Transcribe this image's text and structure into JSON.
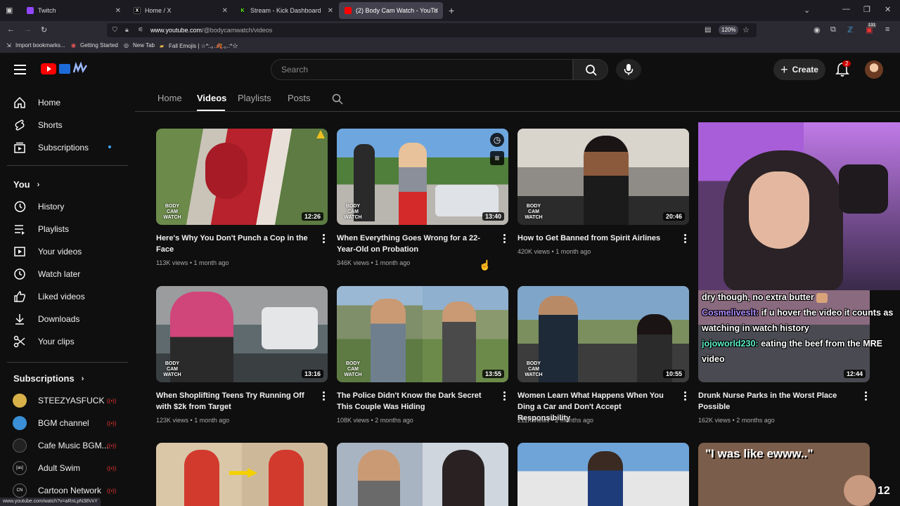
{
  "browser": {
    "tabs": [
      {
        "label": "Twitch",
        "color": "#9146ff",
        "glyph": ""
      },
      {
        "label": "Home / X",
        "color": "#000000",
        "glyph": "X"
      },
      {
        "label": "Stream - Kick Dashboard",
        "color": "#53fc18",
        "glyph": "K"
      },
      {
        "label": "(2) Body Cam Watch - YouTube",
        "color": "#ff0000",
        "glyph": "▶"
      }
    ],
    "url_host": "www.youtube.com",
    "url_path": "/@bodycamwatch/videos",
    "zoom": "120%",
    "bookmarks": [
      "Import bookmarks...",
      "Getting Started",
      "New Tab",
      "Fall Emojis | ☆*:.｡.🍂.｡.:*☆"
    ],
    "ext_badge": "131",
    "status_url": "www.youtube.com/watch?v=aRnLpN38VxY"
  },
  "youtube": {
    "search_placeholder": "Search",
    "create_label": "Create",
    "notif_count": "2"
  },
  "sidebar": {
    "main": [
      {
        "label": "Home",
        "icon": "home-icon"
      },
      {
        "label": "Shorts",
        "icon": "shorts-icon"
      },
      {
        "label": "Subscriptions",
        "icon": "subscriptions-icon"
      }
    ],
    "you_header": "You",
    "you_items": [
      {
        "label": "History",
        "icon": "history-icon"
      },
      {
        "label": "Playlists",
        "icon": "playlists-icon"
      },
      {
        "label": "Your videos",
        "icon": "your-videos-icon"
      },
      {
        "label": "Watch later",
        "icon": "watch-later-icon"
      },
      {
        "label": "Liked videos",
        "icon": "liked-videos-icon"
      },
      {
        "label": "Downloads",
        "icon": "downloads-icon"
      },
      {
        "label": "Your clips",
        "icon": "clips-icon"
      }
    ],
    "subs_header": "Subscriptions",
    "subs": [
      {
        "label": "STEEZYASFUCK",
        "color": "#d8b04a"
      },
      {
        "label": "BGM channel",
        "color": "#3a8fd6"
      },
      {
        "label": "Cafe Music BGM...",
        "color": "#222222"
      },
      {
        "label": "Adult Swim",
        "color": "#111111"
      },
      {
        "label": "Cartoon Network",
        "color": "#111111"
      }
    ]
  },
  "channel_tabs": [
    "Home",
    "Videos",
    "Playlists",
    "Posts"
  ],
  "videos": [
    {
      "title": "Here's Why You Don't Punch a Cop in the Face",
      "views": "113K views",
      "age": "1 month ago",
      "duration": "12:26"
    },
    {
      "title": "When Everything Goes Wrong for a 22-Year-Old on Probation",
      "views": "346K views",
      "age": "1 month ago",
      "duration": "13:40"
    },
    {
      "title": "How to Get Banned from Spirit Airlines",
      "views": "420K views",
      "age": "1 month ago",
      "duration": "20:46"
    },
    {
      "title": "When Shoplifting Teens Try Running Off with $2k from Target",
      "views": "123K views",
      "age": "1 month ago",
      "duration": "13:16"
    },
    {
      "title": "The Police Didn't Know the Dark Secret This Couple Was Hiding",
      "views": "108K views",
      "age": "2 months ago",
      "duration": "13:55"
    },
    {
      "title": "Women Learn What Happens When You Ding a Car and Don't Accept Responsibility",
      "views": "211K views",
      "age": "2 months ago",
      "duration": "10:55"
    },
    {
      "title": "Drunk Nurse Parks in the Worst Place Possible",
      "views": "162K views",
      "age": "2 months ago",
      "duration": "12:44"
    }
  ],
  "thumb_watermark": "BODY CAM WATCH",
  "overlay": {
    "chat": [
      {
        "user": "",
        "text": "dry though, no extra butter"
      },
      {
        "user": "Cosmeliveslt:",
        "text": "if u hover the video it counts as watching in watch history"
      },
      {
        "user": "jojoworld230:",
        "text": "eating the beef from the MRE video"
      }
    ],
    "thumb_caption": "\"I was like ewww..\"",
    "viewer_count": "12"
  }
}
